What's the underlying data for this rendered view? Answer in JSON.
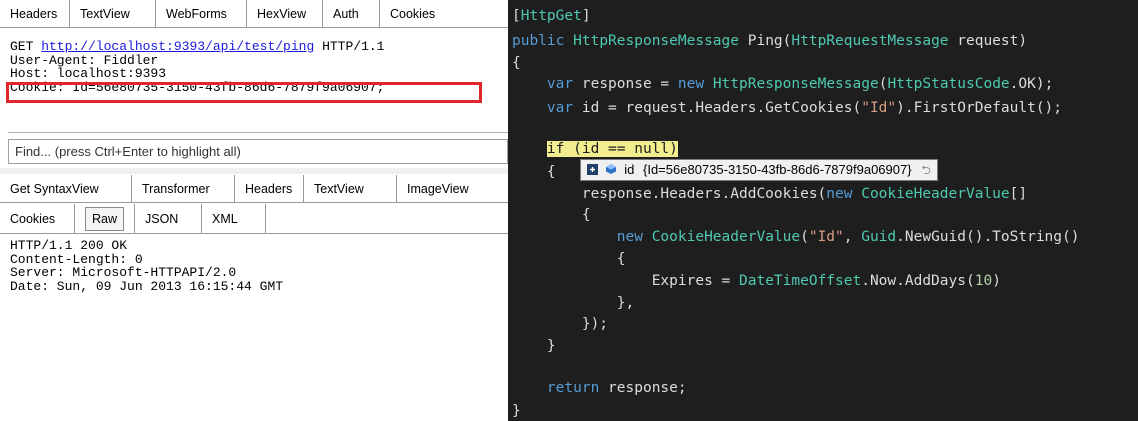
{
  "fiddler": {
    "request_tabs": [
      "Headers",
      "TextView",
      "WebForms",
      "HexView",
      "Auth",
      "Cookies"
    ],
    "request": {
      "method": "GET",
      "url": "http://localhost:9393/api/test/ping",
      "protocol": "HTTP/1.1",
      "user_agent": "User-Agent: Fiddler",
      "host": "Host: localhost:9393",
      "cookie": "Cookie: Id=56e80735-3150-43fb-86d6-7879f9a06907;"
    },
    "find_placeholder": "Find... (press Ctrl+Enter to highlight all)",
    "response_tabs_row1": [
      "Get SyntaxView",
      "Transformer",
      "Headers",
      "TextView",
      "ImageView"
    ],
    "response_tabs_row2": [
      "Cookies",
      "Raw",
      "JSON",
      "XML"
    ],
    "response": {
      "lines": [
        "HTTP/1.1 200 OK",
        "Content-Length: 0",
        "Server: Microsoft-HTTPAPI/2.0",
        "Date: Sun, 09 Jun 2013 16:15:44 GMT"
      ]
    }
  },
  "editor": {
    "datatip": {
      "name": "id",
      "value": "{Id=56e80735-3150-43fb-86d6-7879f9a06907}"
    },
    "tokens": {
      "attr_open": "[",
      "attr_name": "HttpGet",
      "attr_close": "]",
      "public": "public",
      "ret_type": "HttpResponseMessage",
      "method_sig": " Ping(",
      "param_type": "HttpRequestMessage",
      "param_rest": " request)",
      "brace_open": "{",
      "brace_close": "}",
      "var": "var",
      "resp_decl": " response = ",
      "new": "new",
      "resp_type": "HttpResponseMessage",
      "resp_args_open": "(",
      "status_type": "HttpStatusCode",
      "status_rest": ".OK);",
      "id_decl": " id = request.Headers.GetCookies(",
      "id_str": "\"Id\"",
      "id_rest": ").FirstOrDefault();",
      "if_kw": "if",
      "if_cond": " (id == ",
      "null_kw": "null",
      "if_close": ")",
      "add_cookies": "response.Headers.AddCookies(",
      "chv_type": "CookieHeaderValue",
      "arr": "[]",
      "chv_args_open": "(",
      "chv_str": "\"Id\"",
      "guid_pre": ", ",
      "guid_type": "Guid",
      "guid_rest": ".NewGuid().ToString()",
      "expires_pre": "Expires = ",
      "dto_type": "DateTimeOffset",
      "dto_rest": ".Now.AddDays(",
      "days": "10",
      "dto_close": ")",
      "close_init": "},",
      "close_call": "});",
      "return_kw": "return",
      "return_rest": " response;"
    }
  }
}
